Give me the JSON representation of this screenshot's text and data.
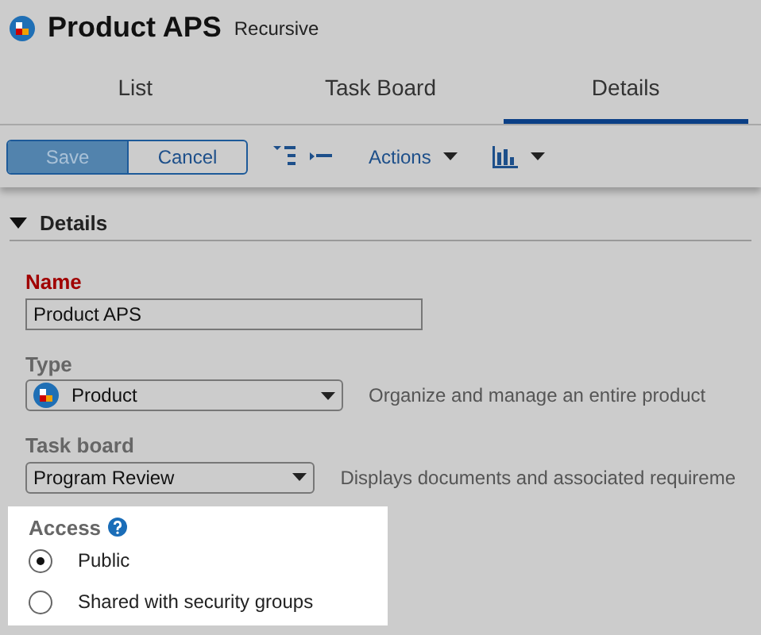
{
  "header": {
    "title": "Product APS",
    "badge": "Recursive"
  },
  "tabs": [
    {
      "label": "List",
      "selected": false
    },
    {
      "label": "Task Board",
      "selected": false
    },
    {
      "label": "Details",
      "selected": true
    }
  ],
  "toolbar": {
    "buttons": [
      {
        "label": "Save",
        "disabled": true
      },
      {
        "label": "Cancel",
        "disabled": false
      }
    ],
    "actions": "Actions"
  },
  "section": {
    "title": "Details",
    "expanded": true,
    "fields": [
      {
        "kind": "text",
        "label": "Name",
        "required": true,
        "value": "Product APS"
      },
      {
        "kind": "select",
        "label": "Type",
        "required": false,
        "value": "Product",
        "icon": true,
        "hint": "Organize and manage an entire product"
      },
      {
        "kind": "select",
        "label": "Task board",
        "required": false,
        "value": "Program Review",
        "icon": false,
        "hint": "Displays documents and associated requireme"
      }
    ]
  },
  "access": {
    "label": "Access",
    "options": [
      {
        "label": "Public",
        "selected": true
      },
      {
        "label": "Shared with security groups",
        "selected": false
      }
    ]
  }
}
